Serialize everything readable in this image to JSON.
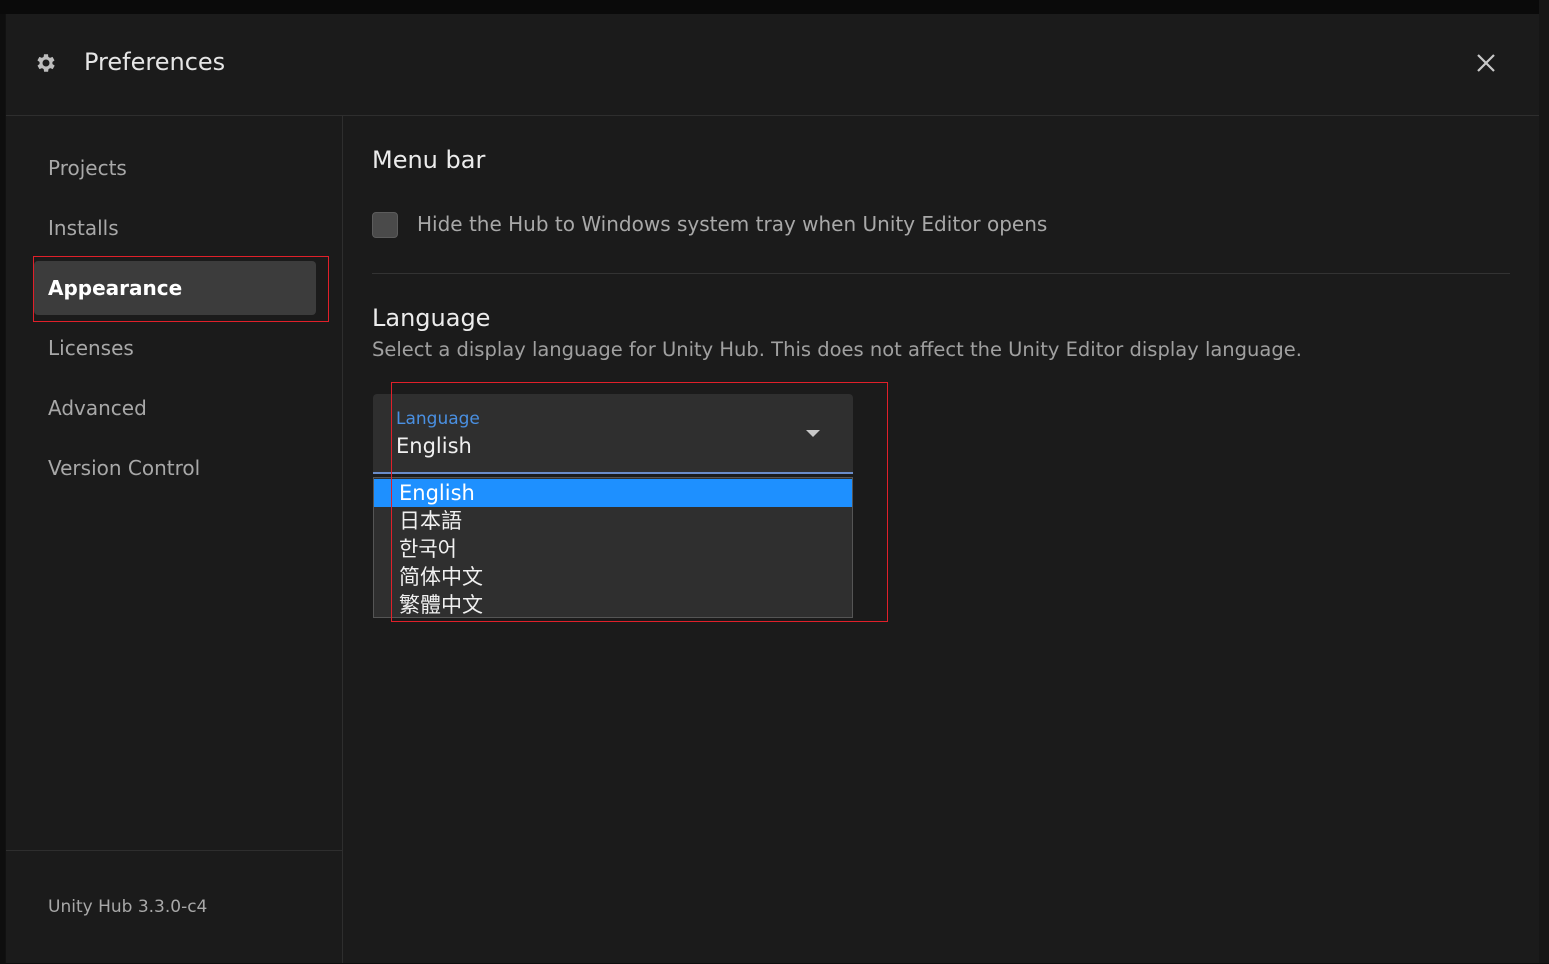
{
  "window": {
    "title": "Preferences"
  },
  "sidebar": {
    "items": [
      {
        "label": "Projects"
      },
      {
        "label": "Installs"
      },
      {
        "label": "Appearance"
      },
      {
        "label": "Licenses"
      },
      {
        "label": "Advanced"
      },
      {
        "label": "Version Control"
      }
    ],
    "active_index": 2,
    "version": "Unity Hub 3.3.0-c4"
  },
  "content": {
    "menu_bar": {
      "title": "Menu bar",
      "checkbox_label": "Hide the Hub to Windows system tray when Unity Editor opens",
      "checked": false
    },
    "language": {
      "title": "Language",
      "description": "Select a display language for Unity Hub. This does not affect the Unity Editor display language.",
      "select_label": "Language",
      "selected_value": "English",
      "options": [
        "English",
        "日本語",
        "한국어",
        "简体中文",
        "繁體中文"
      ]
    }
  },
  "colors": {
    "accent": "#1e90ff",
    "highlight": "#e0202a",
    "background": "#1b1b1b"
  },
  "icons": {
    "header": "gear-icon",
    "close": "close-icon",
    "select": "caret-down-icon"
  }
}
